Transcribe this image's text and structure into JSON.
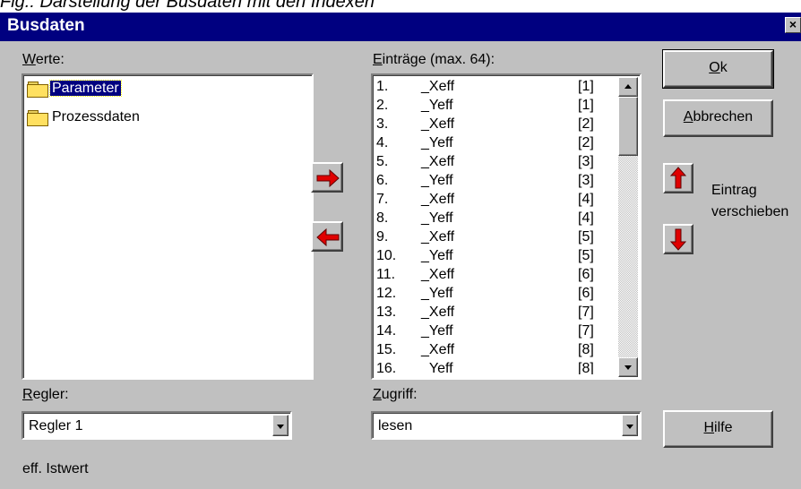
{
  "caption": "Fig.: Darstellung der Busdaten mit den Indexen",
  "window": {
    "title": "Busdaten",
    "close_glyph": "×"
  },
  "werte": {
    "label_u": "W",
    "label_rest": "erte:",
    "items": [
      {
        "label": "Parameter",
        "selected": true,
        "icon": "folder-icon"
      },
      {
        "label": "Prozessdaten",
        "selected": false,
        "icon": "folder-icon"
      }
    ]
  },
  "eintraege": {
    "label_u": "E",
    "label_rest": "inträge (max. 64):",
    "rows": [
      {
        "num": "1.",
        "name": "_Xeff",
        "idx": "[1]"
      },
      {
        "num": "2.",
        "name": "_Yeff",
        "idx": "[1]"
      },
      {
        "num": "3.",
        "name": "_Xeff",
        "idx": "[2]"
      },
      {
        "num": "4.",
        "name": "_Yeff",
        "idx": "[2]"
      },
      {
        "num": "5.",
        "name": "_Xeff",
        "idx": "[3]"
      },
      {
        "num": "6.",
        "name": "_Yeff",
        "idx": "[3]"
      },
      {
        "num": "7.",
        "name": "_Xeff",
        "idx": "[4]"
      },
      {
        "num": "8.",
        "name": "_Yeff",
        "idx": "[4]"
      },
      {
        "num": "9.",
        "name": "_Xeff",
        "idx": "[5]"
      },
      {
        "num": "10.",
        "name": "_Yeff",
        "idx": "[5]"
      },
      {
        "num": "11.",
        "name": "_Xeff",
        "idx": "[6]"
      },
      {
        "num": "12.",
        "name": "_Yeff",
        "idx": "[6]"
      },
      {
        "num": "13.",
        "name": "_Xeff",
        "idx": "[7]"
      },
      {
        "num": "14.",
        "name": "_Yeff",
        "idx": "[7]"
      },
      {
        "num": "15.",
        "name": "_Xeff",
        "idx": "[8]"
      },
      {
        "num": "16.",
        "name": "_Yeff",
        "idx": "[8]"
      }
    ]
  },
  "buttons": {
    "ok_u": "O",
    "ok_rest": "k",
    "abbrechen_u": "A",
    "abbrechen_rest": "bbrechen",
    "hilfe_u": "H",
    "hilfe_rest": "ilfe"
  },
  "move_label_line1": "Eintrag",
  "move_label_line2": "verschieben",
  "regler": {
    "label_u": "R",
    "label_rest": "egler:",
    "value": "Regler 1"
  },
  "zugriff": {
    "label_u": "Z",
    "label_rest": "ugriff:",
    "value": "lesen"
  },
  "status_text": "eff. Istwert",
  "colors": {
    "titlebar": "#000080",
    "dialog": "#c0c0c0",
    "arrow": "#e00000",
    "selection": "#000080"
  }
}
